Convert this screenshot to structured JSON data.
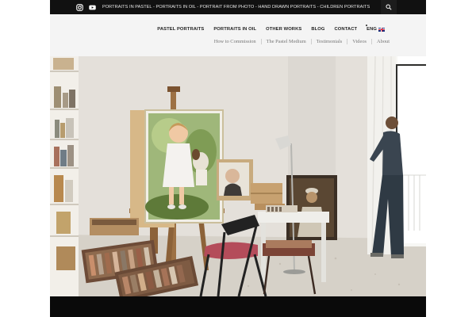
{
  "topbar": {
    "social_icons": [
      "instagram-icon",
      "youtube-icon"
    ],
    "tagline": "PORTRAITS IN PASTEL - PORTRAITS IN OIL - PORTRAIT FROM PHOTO - HAND DRAWN PORTRAITS - CHILDREN PORTRAITS",
    "search_icon": "search-icon"
  },
  "nav_primary": [
    {
      "label": "PASTEL PORTRAITS"
    },
    {
      "label": "PORTRAITS IN OIL"
    },
    {
      "label": "OTHER WORKS"
    },
    {
      "label": "BLOG"
    },
    {
      "label": "CONTACT"
    }
  ],
  "language": {
    "label": "ENG",
    "flag": "uk-flag-icon"
  },
  "nav_secondary": [
    {
      "label": "How to Commission"
    },
    {
      "label": "The Pastel Medium"
    },
    {
      "label": "Testimonials"
    },
    {
      "label": "Videos"
    },
    {
      "label": "About"
    }
  ],
  "hero": {
    "scene": "artist-studio",
    "colors": {
      "wall": "#e6e2dc",
      "floor": "#d9d4cc",
      "canvas": "#7aa14a",
      "easel": "#a0744a"
    }
  }
}
